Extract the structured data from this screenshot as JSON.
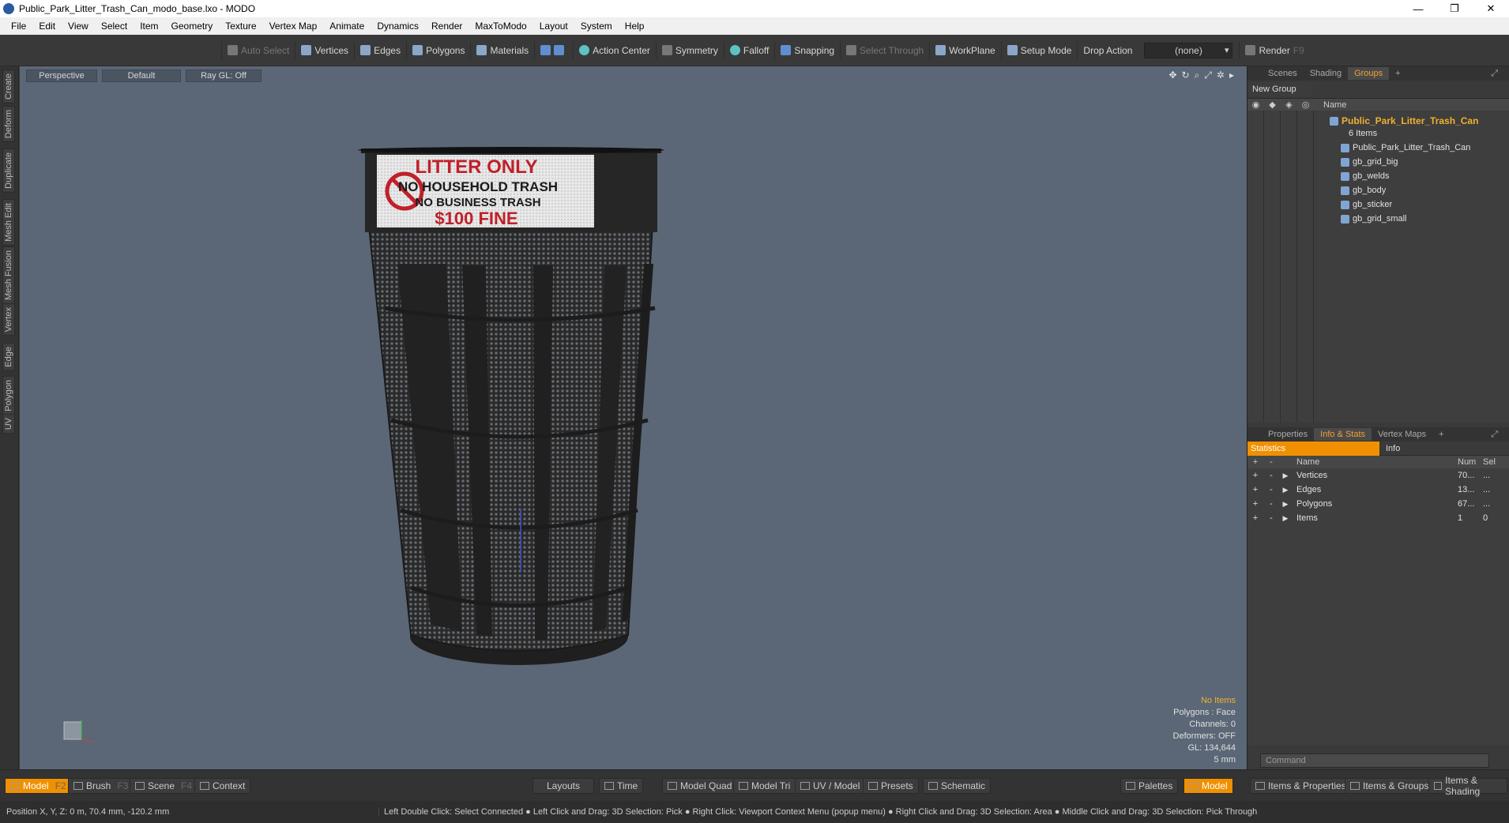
{
  "window": {
    "title": "Public_Park_Litter_Trash_Can_modo_base.lxo - MODO",
    "min": "—",
    "restore": "❐",
    "close": "✕"
  },
  "menu": [
    "File",
    "Edit",
    "View",
    "Select",
    "Item",
    "Geometry",
    "Texture",
    "Vertex Map",
    "Animate",
    "Dynamics",
    "Render",
    "MaxToModo",
    "Layout",
    "System",
    "Help"
  ],
  "toolbar": {
    "auto_select": "Auto Select",
    "vertices": "Vertices",
    "edges": "Edges",
    "polygons": "Polygons",
    "materials": "Materials",
    "action_center": "Action Center",
    "symmetry": "Symmetry",
    "falloff": "Falloff",
    "snapping": "Snapping",
    "select_through": "Select Through",
    "workplane": "WorkPlane",
    "setup_mode": "Setup Mode",
    "drop_action": "Drop Action",
    "drop_value": "(none)",
    "render": "Render",
    "render_key": "F9"
  },
  "left_tabs": [
    "Create",
    "Deform",
    "Duplicate",
    "Mesh Edit",
    "Mesh Fusion",
    "Vertex",
    "Edge",
    "Polygon",
    "UV"
  ],
  "viewport": {
    "view": "Perspective",
    "shading": "Default",
    "raygl": "Ray GL: Off",
    "sign": {
      "line1": "LITTER ONLY",
      "line2": "NO HOUSEHOLD TRASH",
      "line3": "NO BUSINESS TRASH",
      "line4": "$100 FINE"
    },
    "info": {
      "items": "No Items",
      "polygons": "Polygons : Face",
      "channels": "Channels: 0",
      "deformers": "Deformers: OFF",
      "gl": "GL: 134,644",
      "scale": "5 mm"
    }
  },
  "groups_panel": {
    "tabs": [
      "Scenes",
      "Shading",
      "Groups"
    ],
    "active_tab": "Groups",
    "add": "+",
    "new_group": "New Group",
    "name_col": "Name",
    "root": "Public_Park_Litter_Trash_Can",
    "root_count": "6 Items",
    "children": [
      "Public_Park_Litter_Trash_Can",
      "gb_grid_big",
      "gb_welds",
      "gb_body",
      "gb_sticker",
      "gb_grid_small"
    ]
  },
  "stats_panel": {
    "tabs": [
      "Properties",
      "Info & Stats",
      "Vertex Maps"
    ],
    "active_tab": "Info & Stats",
    "add": "+",
    "statistics": "Statistics",
    "info": "Info",
    "cols": {
      "name": "Name",
      "num": "Num",
      "sel": "Sel"
    },
    "rows": [
      {
        "name": "Vertices",
        "num": "70...",
        "sel": "..."
      },
      {
        "name": "Edges",
        "num": "13...",
        "sel": "..."
      },
      {
        "name": "Polygons",
        "num": "67...",
        "sel": "..."
      },
      {
        "name": "Items",
        "num": "1",
        "sel": "0"
      }
    ],
    "command_placeholder": "Command"
  },
  "bottom": {
    "model": "Model",
    "model_key": "F2",
    "brush": "Brush",
    "brush_key": "F3",
    "scene": "Scene",
    "scene_key": "F4",
    "context": "Context",
    "layouts": "Layouts",
    "time": "Time",
    "model_quad": "Model Quad",
    "model_tri": "Model Tri",
    "uv_model": "UV / Model",
    "presets": "Presets",
    "schematic": "Schematic",
    "palettes": "Palettes",
    "model2": "Model",
    "items_props": "Items & Properties",
    "items_groups": "Items & Groups",
    "items_shading": "Items & Shading"
  },
  "status": {
    "position": "Position X, Y, Z:  0 m, 70.4 mm, -120.2 mm",
    "hint": "Left Double Click: Select Connected ● Left Click and Drag: 3D Selection: Pick ● Right Click: Viewport Context Menu (popup menu) ● Right Click and Drag: 3D Selection: Area ● Middle Click and Drag: 3D Selection: Pick Through"
  }
}
